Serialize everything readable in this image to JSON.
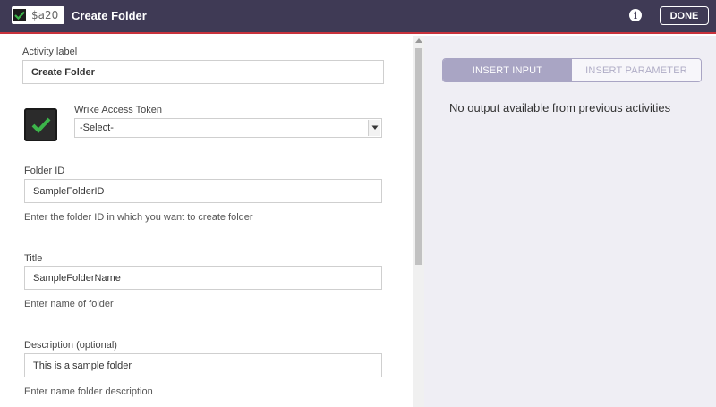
{
  "header": {
    "badge_text": "$a20",
    "title": "Create Folder",
    "info_icon_glyph": "i",
    "done_label": "DONE",
    "background_color": "#3f3a55",
    "accent_line_color": "#c8323c"
  },
  "form": {
    "activity_label": {
      "label": "Activity label",
      "value": "Create Folder"
    },
    "access_token": {
      "label": "Wrike Access Token",
      "selected": "-Select-"
    },
    "folder_id": {
      "label": "Folder ID",
      "value": "SampleFolderID",
      "hint": "Enter the folder ID in which you want to create folder"
    },
    "title": {
      "label": "Title",
      "value": "SampleFolderName",
      "hint": "Enter name of folder"
    },
    "description": {
      "label": "Description (optional)",
      "value": "This is a sample folder",
      "hint": "Enter name folder description"
    }
  },
  "right_panel": {
    "tabs": [
      {
        "label": "INSERT INPUT",
        "active": true
      },
      {
        "label": "INSERT PARAMETER",
        "active": false
      }
    ],
    "empty_message": "No output available from previous activities"
  },
  "icons": {
    "badge": "checkmark-icon",
    "app": "wrike-check-icon",
    "info": "info-icon",
    "select": "chevron-down-icon"
  },
  "colors": {
    "check_green": "#3cb54a",
    "tab_active": "#a9a5c4"
  }
}
